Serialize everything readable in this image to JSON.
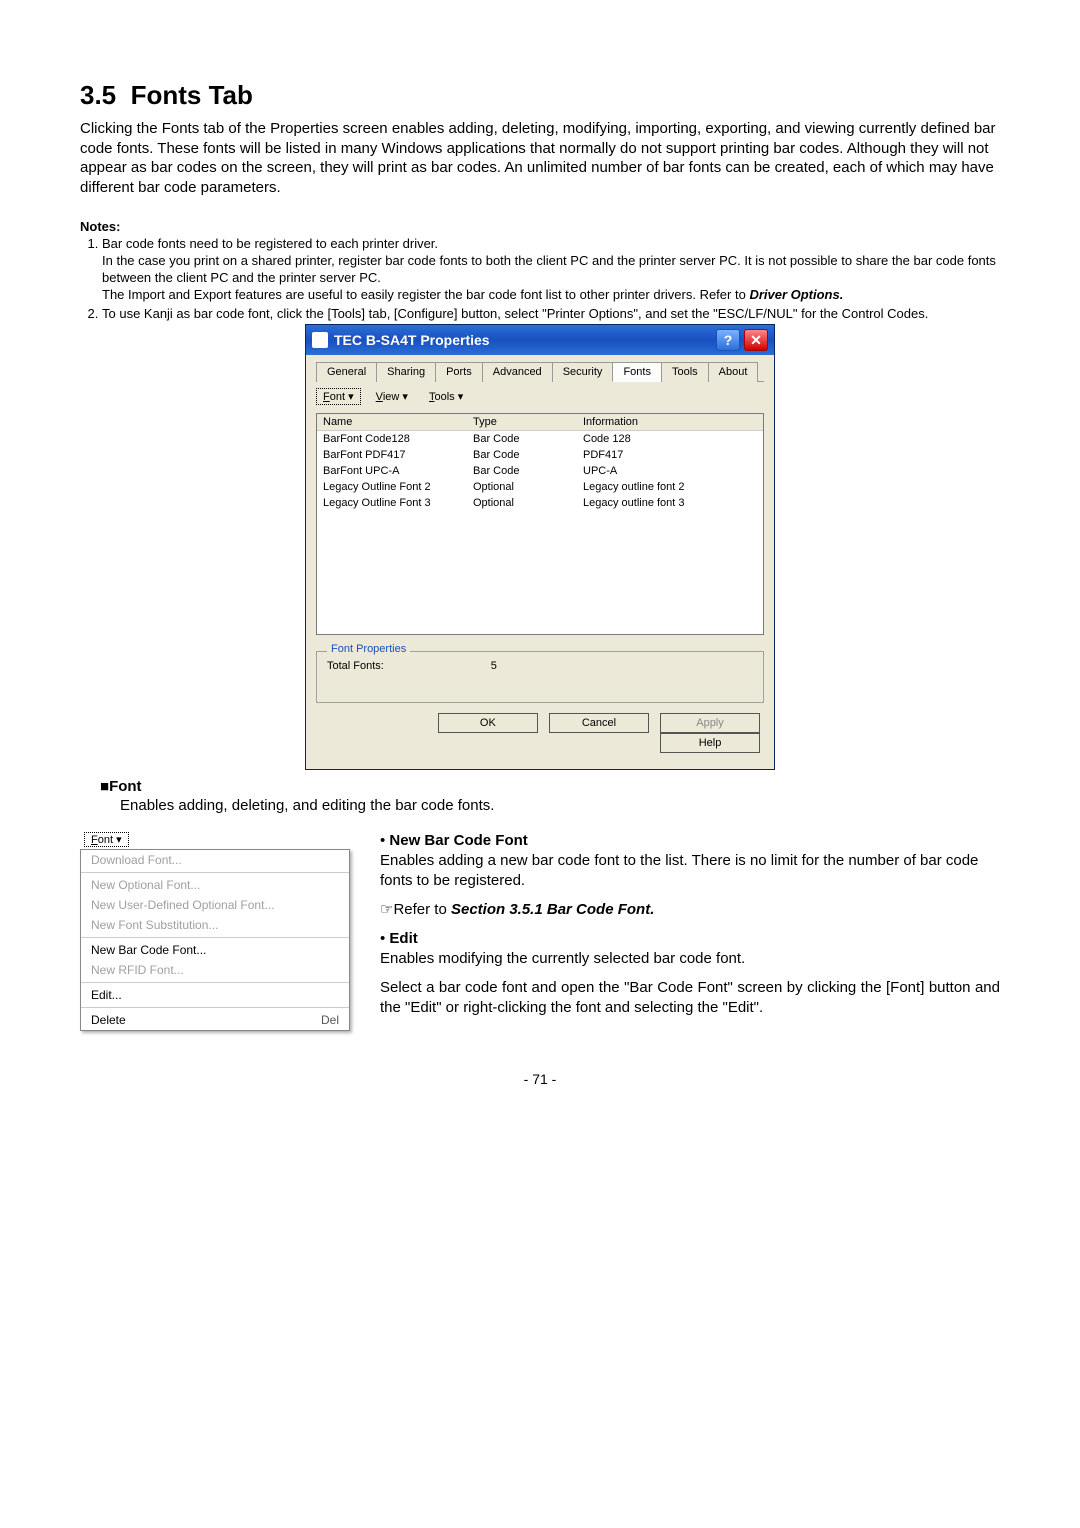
{
  "section": {
    "number": "3.5",
    "title": "Fonts Tab",
    "intro": "Clicking the Fonts tab of the Properties screen enables adding, deleting, modifying, importing, exporting, and viewing currently defined bar code fonts.   These fonts will be listed in many Windows applications that normally do not support printing bar codes.   Although they will not appear as bar codes on the screen, they will print as bar codes.   An unlimited number of bar fonts can be created, each of which may have different bar code parameters."
  },
  "notes": {
    "label": "Notes:",
    "items": [
      {
        "lead": "Bar code fonts need to be registered to each printer driver.",
        "body1": "In the case you print on a shared printer, register bar code fonts to both the client PC and the printer server PC.   It is not possible to share the bar code fonts between the client PC and the printer server PC.",
        "body2_pre": "The Import and Export features are useful to easily register the bar code font list to other printer drivers.   Refer to ",
        "body2_link": "Driver Options."
      },
      {
        "lead": "To use Kanji as bar code font, click the [Tools] tab, [Configure] button, select \"Printer Options\", and set the \"ESC/LF/NUL\" for the Control Codes."
      }
    ]
  },
  "dialog": {
    "title": "TEC B-SA4T Properties",
    "tabs": [
      "General",
      "Sharing",
      "Ports",
      "Advanced",
      "Security",
      "Fonts",
      "Tools",
      "About"
    ],
    "activeTab": "Fonts",
    "menus": {
      "font": "Font",
      "view": "View",
      "tools": "Tools"
    },
    "columns": {
      "name": "Name",
      "type": "Type",
      "info": "Information"
    },
    "rows": [
      {
        "name": "BarFont Code128",
        "type": "Bar Code",
        "info": "Code 128"
      },
      {
        "name": "BarFont PDF417",
        "type": "Bar Code",
        "info": "PDF417"
      },
      {
        "name": "BarFont UPC-A",
        "type": "Bar Code",
        "info": "UPC-A"
      },
      {
        "name": "Legacy Outline Font 2",
        "type": "Optional",
        "info": "Legacy outline font 2"
      },
      {
        "name": "Legacy Outline Font 3",
        "type": "Optional",
        "info": "Legacy outline font 3"
      }
    ],
    "fontprops": {
      "legend": "Font Properties",
      "label": "Total Fonts:",
      "value": "5"
    },
    "buttons": {
      "ok": "OK",
      "cancel": "Cancel",
      "apply": "Apply",
      "help": "Help"
    }
  },
  "font_section": {
    "heading": "Font",
    "desc": "Enables adding, deleting, and editing the bar code fonts."
  },
  "dropdown": {
    "button": "Font",
    "items": [
      {
        "label": "Download Font...",
        "enabled": false
      },
      {
        "sep": true
      },
      {
        "label": "New Optional Font...",
        "enabled": false
      },
      {
        "label": "New User-Defined Optional Font...",
        "enabled": false
      },
      {
        "label": "New Font Substitution...",
        "enabled": false
      },
      {
        "sep": true
      },
      {
        "label": "New Bar Code Font...",
        "enabled": true
      },
      {
        "label": "New RFID Font...",
        "enabled": false
      },
      {
        "sep": true
      },
      {
        "label": "Edit...",
        "enabled": true
      },
      {
        "sep": true
      },
      {
        "label": "Delete",
        "enabled": true,
        "shortcut": "Del"
      }
    ]
  },
  "right": {
    "nbcf_title": "New Bar Code Font",
    "nbcf_body": "Enables adding a new bar code font to the list.   There is no limit for the number of bar code fonts to be registered.",
    "refer_pre": "Refer to ",
    "refer_link": "Section 3.5.1 Bar Code Font.",
    "edit_title": "Edit",
    "edit_body1": "Enables modifying the currently selected bar code font.",
    "edit_body2": "Select a bar code font and open the \"Bar Code Font\" screen by clicking the [Font] button and the \"Edit\" or right-clicking the font and selecting the \"Edit\"."
  },
  "page": "- 71 -"
}
